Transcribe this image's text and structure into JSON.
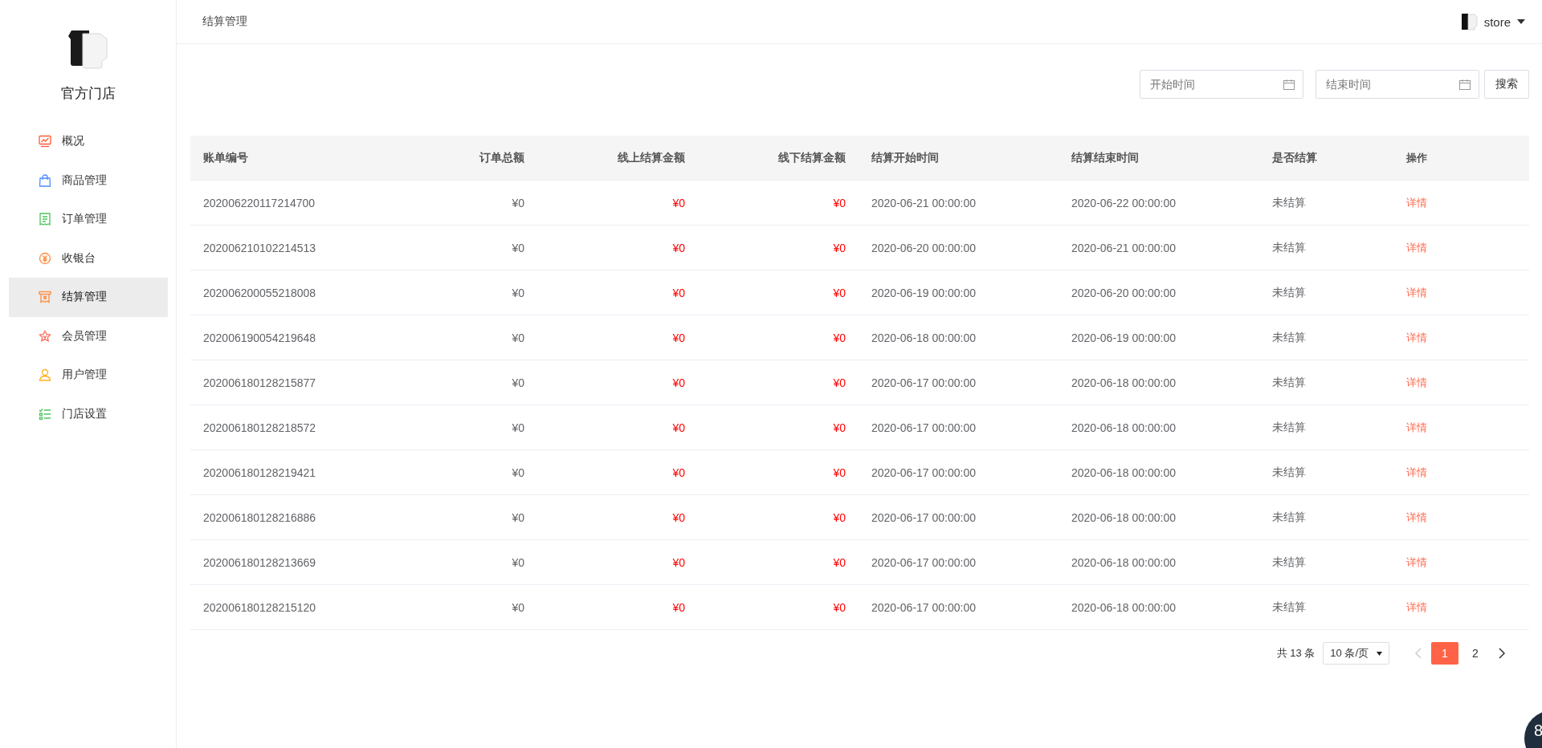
{
  "sidebar": {
    "title": "官方门店",
    "items": [
      {
        "label": "概况",
        "selected": false
      },
      {
        "label": "商品管理",
        "selected": false
      },
      {
        "label": "订单管理",
        "selected": false
      },
      {
        "label": "收银台",
        "selected": false
      },
      {
        "label": "结算管理",
        "selected": true
      },
      {
        "label": "会员管理",
        "selected": false
      },
      {
        "label": "用户管理",
        "selected": false
      },
      {
        "label": "门店设置",
        "selected": false
      }
    ]
  },
  "header": {
    "title": "结算管理",
    "user": "store"
  },
  "filters": {
    "start_placeholder": "开始时间",
    "end_placeholder": "结束时间",
    "search_button": "搜索"
  },
  "table": {
    "columns": [
      "账单编号",
      "订单总额",
      "线上结算金额",
      "线下结算金额",
      "结算开始时间",
      "结算结束时间",
      "是否结算",
      "操作"
    ],
    "rows": [
      [
        "202006220117214700",
        "¥0",
        "¥0",
        "¥0",
        "2020-06-21 00:00:00",
        "2020-06-22 00:00:00",
        "未结算",
        "详情"
      ],
      [
        "202006210102214513",
        "¥0",
        "¥0",
        "¥0",
        "2020-06-20 00:00:00",
        "2020-06-21 00:00:00",
        "未结算",
        "详情"
      ],
      [
        "202006200055218008",
        "¥0",
        "¥0",
        "¥0",
        "2020-06-19 00:00:00",
        "2020-06-20 00:00:00",
        "未结算",
        "详情"
      ],
      [
        "202006190054219648",
        "¥0",
        "¥0",
        "¥0",
        "2020-06-18 00:00:00",
        "2020-06-19 00:00:00",
        "未结算",
        "详情"
      ],
      [
        "202006180128215877",
        "¥0",
        "¥0",
        "¥0",
        "2020-06-17 00:00:00",
        "2020-06-18 00:00:00",
        "未结算",
        "详情"
      ],
      [
        "202006180128218572",
        "¥0",
        "¥0",
        "¥0",
        "2020-06-17 00:00:00",
        "2020-06-18 00:00:00",
        "未结算",
        "详情"
      ],
      [
        "202006180128219421",
        "¥0",
        "¥0",
        "¥0",
        "2020-06-17 00:00:00",
        "2020-06-18 00:00:00",
        "未结算",
        "详情"
      ],
      [
        "202006180128216886",
        "¥0",
        "¥0",
        "¥0",
        "2020-06-17 00:00:00",
        "2020-06-18 00:00:00",
        "未结算",
        "详情"
      ],
      [
        "202006180128213669",
        "¥0",
        "¥0",
        "¥0",
        "2020-06-17 00:00:00",
        "2020-06-18 00:00:00",
        "未结算",
        "详情"
      ],
      [
        "202006180128215120",
        "¥0",
        "¥0",
        "¥0",
        "2020-06-17 00:00:00",
        "2020-06-18 00:00:00",
        "未结算",
        "详情"
      ]
    ]
  },
  "pagination": {
    "total": "共 13 条",
    "page_size": "10 条/页",
    "pages": [
      {
        "label": "1",
        "selected": true
      },
      {
        "label": "2",
        "selected": false
      }
    ]
  },
  "floating_badge": "8"
}
